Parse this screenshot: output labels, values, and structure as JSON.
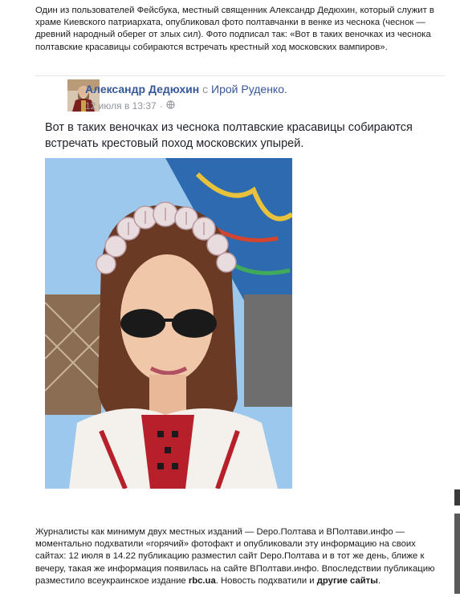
{
  "intro_text": "Один из пользователей Фейсбука, местный священник Александр Дедюхин, который служит в храме Киевского патриархата, опубликовал фото полтавчанки в венке из чеснока (чеснок — древний народный оберег от злых сил). Фото подписал так: «Вот в таких веночках из чеснока полтавские красавицы собираются встречать крестный ход московских вампиров».",
  "post": {
    "author": "Александр Дедюхин",
    "with_text": "с",
    "tagged": "Ирой Руденко.",
    "date": "12 июля в 13:37",
    "separator": "·",
    "privacy_icon": "globe-icon",
    "text": "Вот в таких веночках из чеснока полтавские красавицы собираются встречать крестовый поход московских упырей."
  },
  "outro": {
    "part1": "Журналисты как минимум двух местных изданий — Depo.Полтава и ВПолтави.инфо — моментально подхватили «горячий» фотофакт и опубликовали эту информацию на своих сайтах: 12 июля в 14.22 публикацию разместил сайт Depo.Полтава и в тот же день, ближе к вечеру, такая же информация появилась на сайте ВПолтави.инфо. Впоследствии публикацию разместило всеукраинское издание ",
    "bold1": "rbc.ua",
    "part2": ". Новость подхватили и ",
    "bold2": "другие сайты",
    "part3": "."
  },
  "colors": {
    "link": "#365899",
    "muted": "#90949c"
  }
}
